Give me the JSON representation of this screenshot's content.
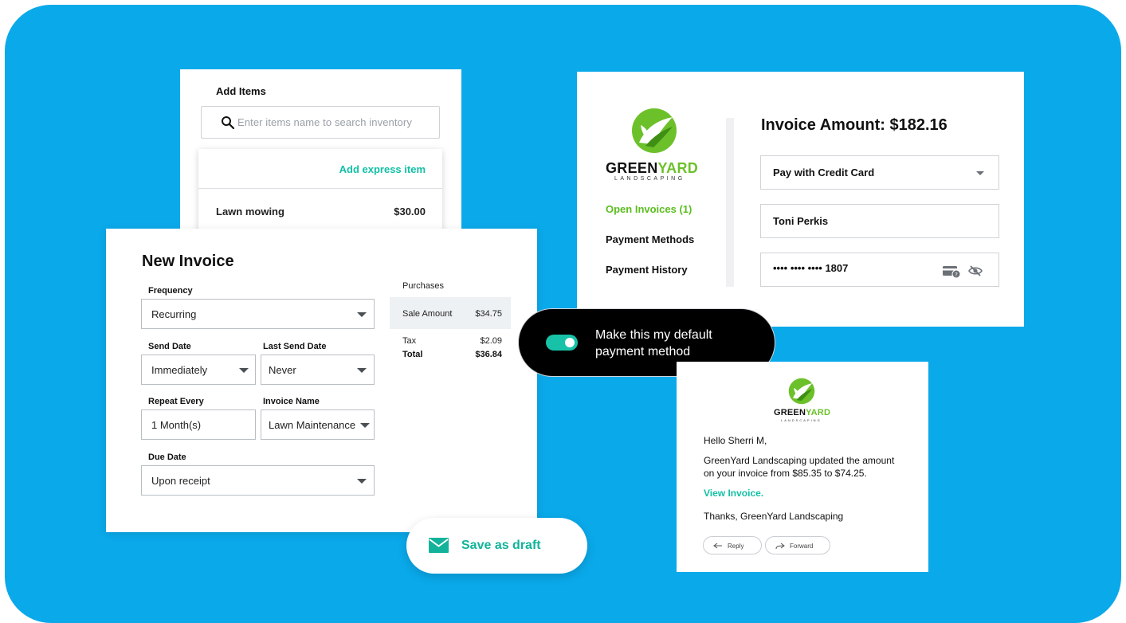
{
  "add_items": {
    "title": "Add Items",
    "search_placeholder": "Enter items name to search inventory",
    "express_link": "Add express item",
    "items": [
      {
        "name": "Lawn mowing",
        "price": "$30.00"
      }
    ]
  },
  "new_invoice": {
    "title": "New Invoice",
    "frequency_label": "Frequency",
    "frequency_value": "Recurring",
    "send_date_label": "Send Date",
    "send_date_value": "Immediately",
    "last_send_label": "Last Send Date",
    "last_send_value": "Never",
    "repeat_label": "Repeat Every",
    "repeat_value": "1 Month(s)",
    "invoice_name_label": "Invoice Name",
    "invoice_name_value": "Lawn Maintenance",
    "due_date_label": "Due Date",
    "due_date_value": "Upon receipt",
    "purchases": {
      "title": "Purchases",
      "sale_label": "Sale Amount",
      "sale_value": "$34.75",
      "tax_label": "Tax",
      "tax_value": "$2.09",
      "total_label": "Total",
      "total_value": "$36.84"
    }
  },
  "draft_button": {
    "label": "Save as draft"
  },
  "payment": {
    "brand_main": "GREEN",
    "brand_accent": "YARD",
    "brand_sub": "LANDSCAPING",
    "nav": [
      "Open Invoices (1)",
      "Payment Methods",
      "Payment History"
    ],
    "amount_title": "Invoice Amount: $182.16",
    "method_value": "Pay with Credit Card",
    "name_value": "Toni Perkis",
    "card_value": "•••• •••• •••• 1807"
  },
  "default_toggle": {
    "line1": "Make this my default",
    "line2": "payment method",
    "checked": true
  },
  "email": {
    "brand_main": "GREEN",
    "brand_accent": "YARD",
    "brand_sub": "LANDSCAPING",
    "greeting": "Hello Sherri M,",
    "body_line1": "GreenYard Landscaping updated the amount",
    "body_line2": "on your invoice from $85.35 to $74.25.",
    "link": "View Invoice.",
    "signoff": "Thanks, GreenYard Landscaping",
    "reply_label": "Reply",
    "forward_label": "Forward"
  },
  "colors": {
    "background": "#0aa9ea",
    "accent_teal": "#12c0a6",
    "brand_green": "#6cc12a",
    "toggle_bg": "#000000"
  }
}
